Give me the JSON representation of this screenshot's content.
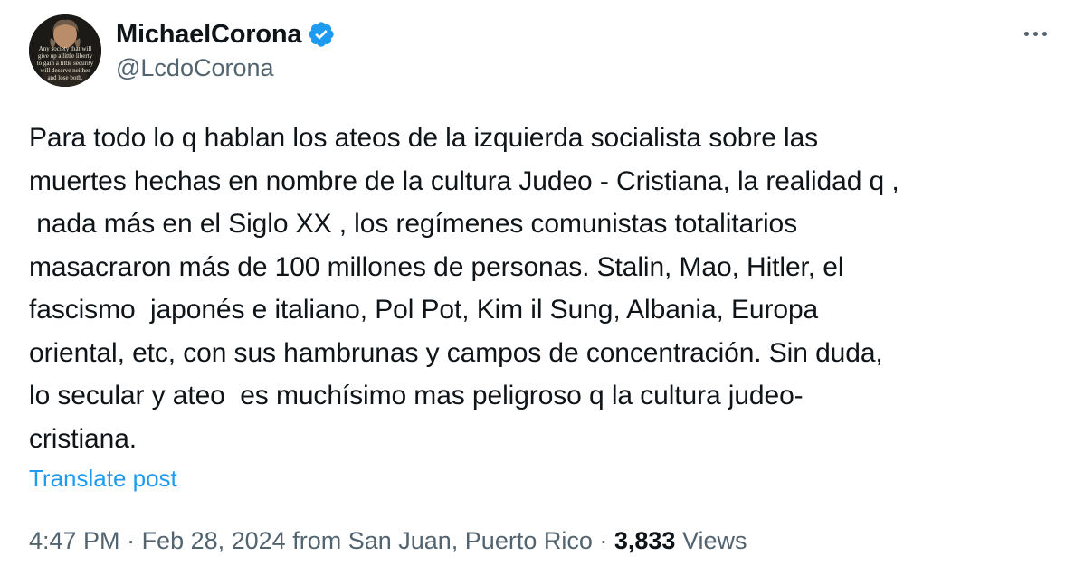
{
  "author": {
    "display_name": "MichaelCorona",
    "handle": "@LcdoCorona",
    "verified": true,
    "verified_color": "#1d9bf0",
    "avatar_quote": "Any society that will\ngive up a little liberty\nto gain a little security\nwill deserve neither\nand lose both."
  },
  "post": {
    "text_lines": [
      "Para todo lo q hablan los ateos de la izquierda socialista sobre las",
      "muertes hechas en nombre de la cultura Judeo - Cristiana, la realidad q ,",
      " nada más en el Siglo XX , los regímenes comunistas totalitarios",
      "masacraron más de 100 millones de personas. Stalin, Mao, Hitler, el",
      "fascismo  japonés e italiano, Pol Pot, Kim il Sung, Albania, Europa",
      "oriental, etc, con sus hambrunas y campos de concentración. Sin duda,",
      "lo secular y ateo  es muchísimo mas peligroso q la cultura judeo-",
      "cristiana."
    ],
    "translate_label": "Translate post"
  },
  "meta": {
    "time": "4:47 PM",
    "separator": " · ",
    "date": "Feb 28, 2024",
    "source": " from San Juan, Puerto Rico",
    "views_count": "3,833",
    "views_label": " Views"
  },
  "icons": {
    "verified": "verified-badge-icon",
    "more": "more-options-icon"
  },
  "colors": {
    "text_primary": "#0f1419",
    "text_secondary": "#536471",
    "link": "#1d9bf0"
  }
}
